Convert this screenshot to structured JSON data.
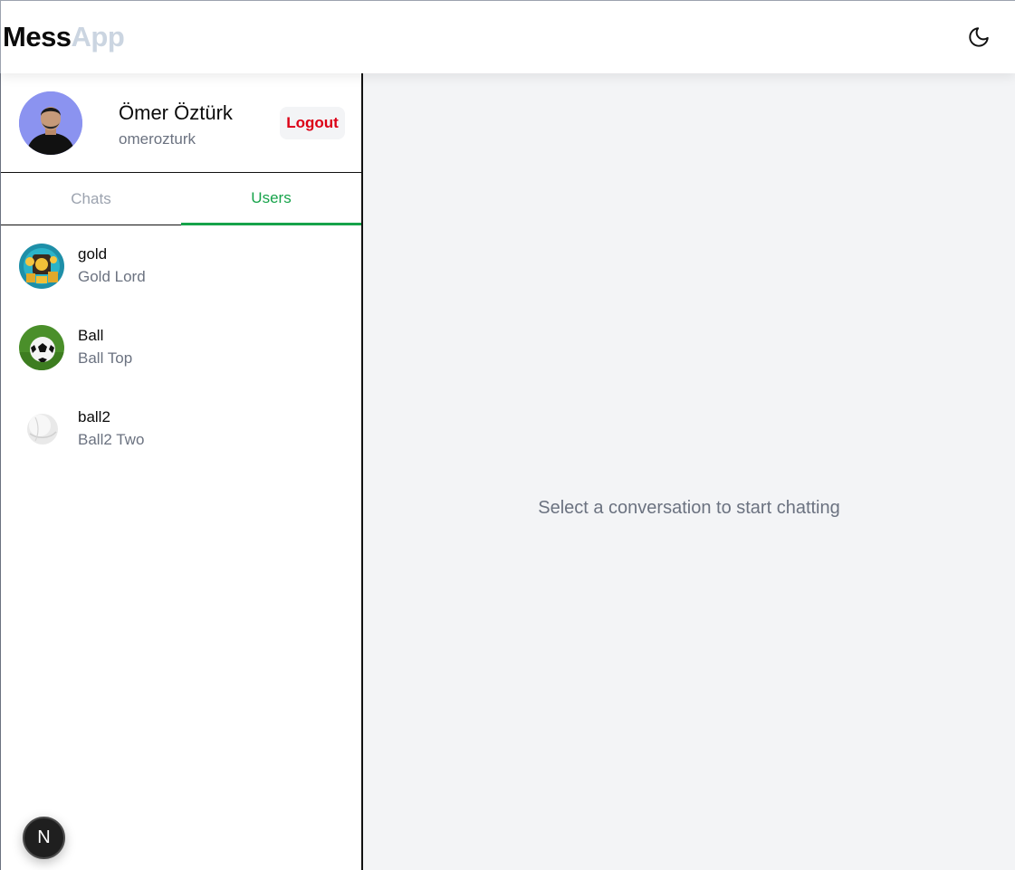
{
  "header": {
    "logo_part1": "Mess",
    "logo_part2": "App",
    "theme_toggle_icon": "moon-icon",
    "colors": {
      "logo_main": "#0b0b0b",
      "logo_accent": "#cbd5e1"
    }
  },
  "profile": {
    "name": "Ömer Öztürk",
    "username": "omerozturk",
    "logout_label": "Logout",
    "avatar_icon": "user-avatar",
    "colors": {
      "logout_text": "#dc0016",
      "avatar_bg": "#8b93f0"
    }
  },
  "tabs": [
    {
      "label": "Chats",
      "active": false
    },
    {
      "label": "Users",
      "active": true
    }
  ],
  "users": [
    {
      "handle": "gold",
      "display_name": "Gold Lord",
      "avatar_icon": "gold-coins-avatar"
    },
    {
      "handle": "Ball",
      "display_name": "Ball Top",
      "avatar_icon": "soccer-ball-avatar"
    },
    {
      "handle": "ball2",
      "display_name": "Ball2 Two",
      "avatar_icon": "white-ball-avatar"
    }
  ],
  "main": {
    "empty_message": "Select a conversation to start chatting"
  },
  "dev_badge": {
    "label": "N",
    "icon": "nextjs-icon"
  },
  "colors": {
    "accent": "#16a34a",
    "muted": "#6b7280",
    "main_bg": "#f3f4f6"
  }
}
